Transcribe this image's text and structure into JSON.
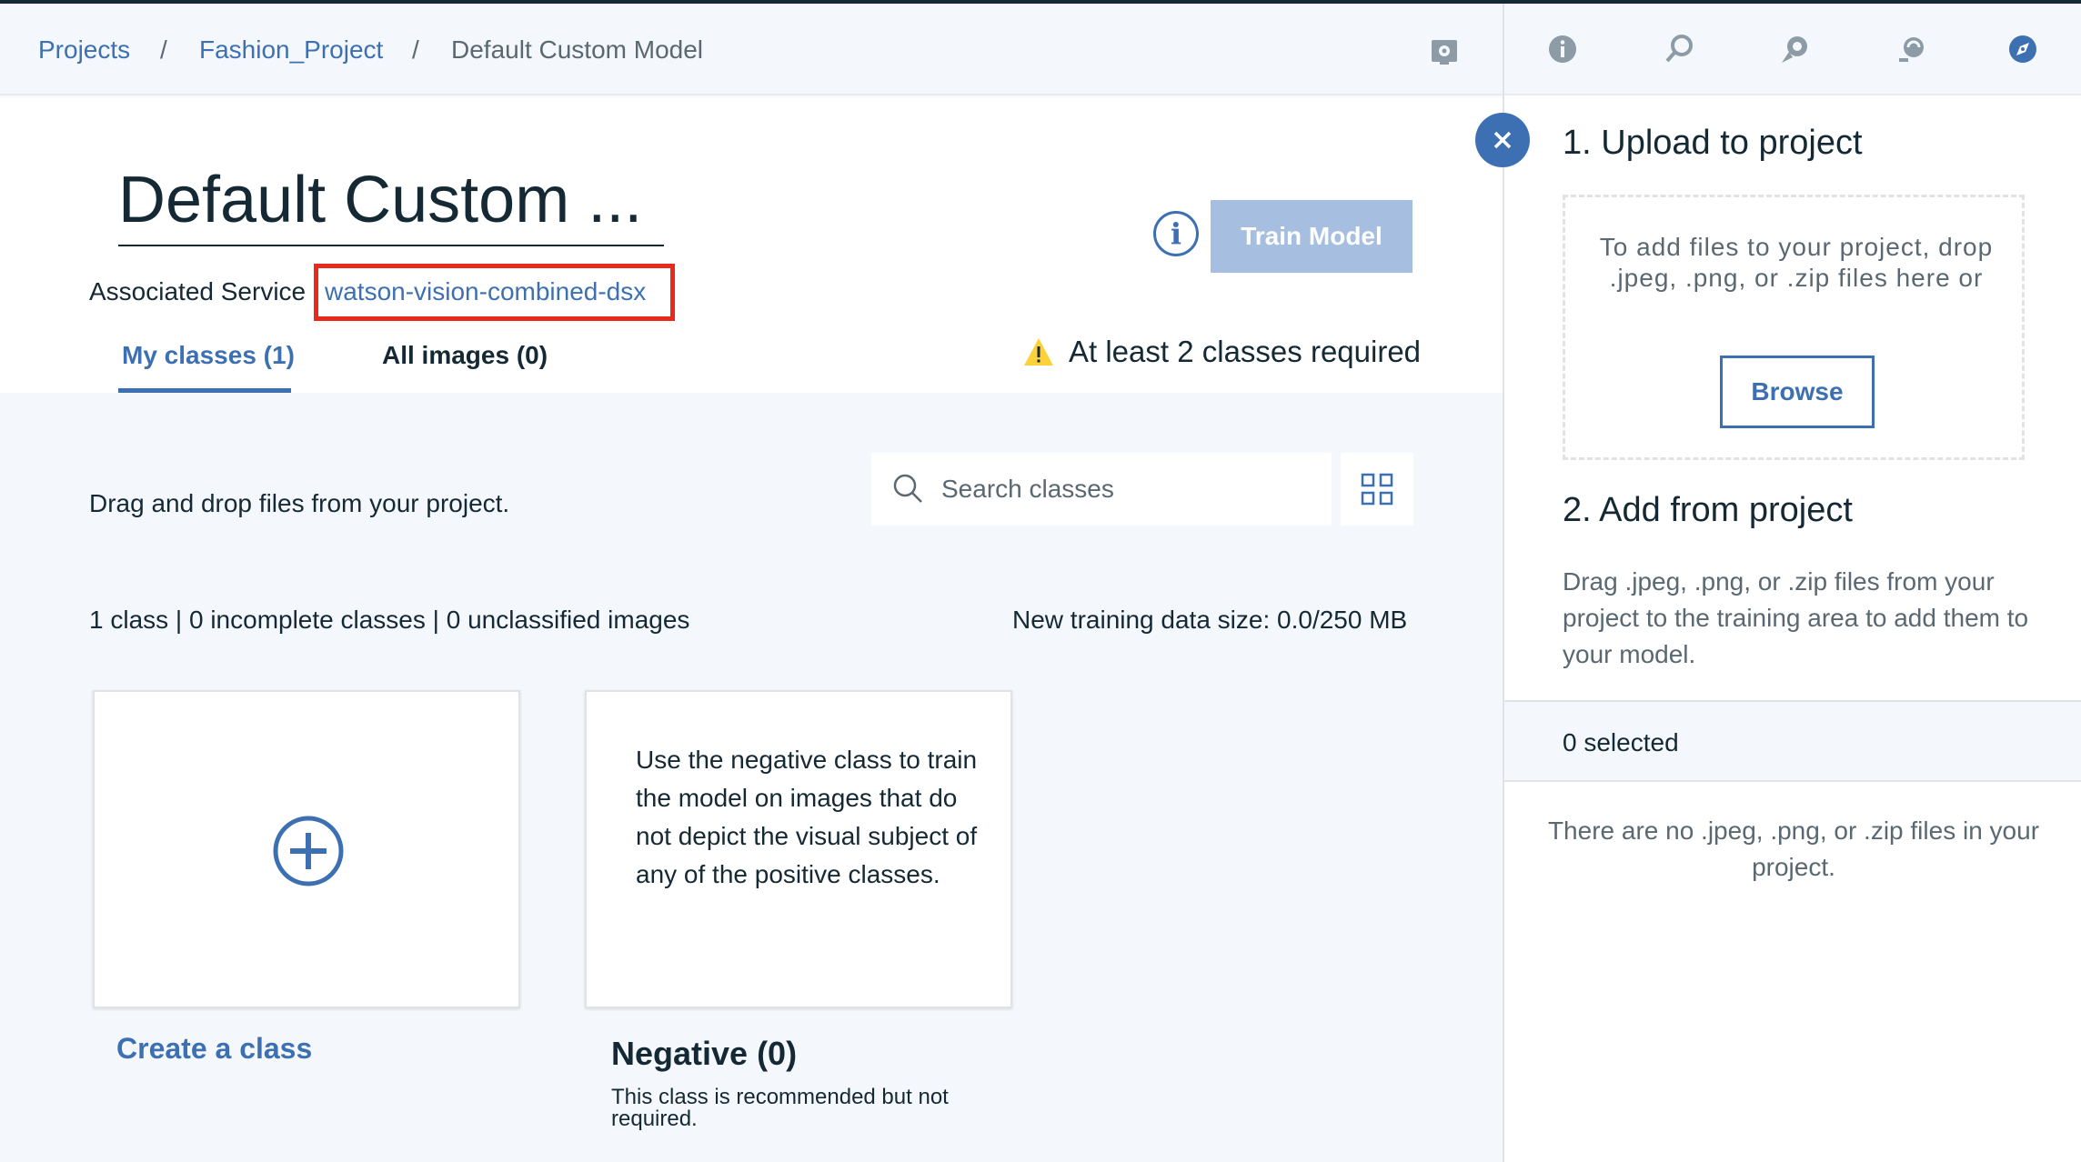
{
  "breadcrumb": {
    "items": [
      "Projects",
      "Fashion_Project",
      "Default Custom Model"
    ],
    "separator": "/"
  },
  "model": {
    "title": "Default Custom ...",
    "associated_service_label": "Associated Service",
    "associated_service_value": "watson-vision-combined-dsx"
  },
  "actions": {
    "info_glyph": "i",
    "train_label": "Train Model",
    "warning": "At least 2 classes required"
  },
  "tabs": [
    {
      "label": "My classes (1)",
      "active": true
    },
    {
      "label": "All images (0)",
      "active": false
    }
  ],
  "content": {
    "drag_hint": "Drag and drop files from your project.",
    "search_placeholder": "Search classes",
    "stats": "1 class | 0 incomplete classes | 0 unclassified images",
    "data_size": "New training data size: 0.0/250 MB"
  },
  "cards": {
    "create_label": "Create a class",
    "negative_desc": "Use the negative class to train the model on images that do not depict the visual subject of any of the positive classes.",
    "negative_title": "Negative (0)",
    "negative_note": "This class is recommended but not required."
  },
  "panel": {
    "toolbar_icons": [
      "settings-icon",
      "info-icon",
      "find-data-icon",
      "environments-icon",
      "data-assets-icon",
      "compass-icon"
    ],
    "active_tool": "data-assets-icon",
    "upload_heading": "1. Upload to project",
    "drop_text": "To add files to your project, drop .jpeg, .png, or .zip files here or",
    "browse_label": "Browse",
    "add_heading": "2. Add from project",
    "add_desc": "Drag .jpeg, .png, or .zip files from your project to the training area to add them to your model.",
    "selected_text": "0 selected",
    "empty_text": "There are no .jpeg, .png, or .zip files in your project."
  },
  "colors": {
    "accent": "#3d70b2",
    "train_disabled": "#a6bfe0",
    "highlight_box": "#e8291c",
    "warning": "#fdd13a",
    "text": "#152935",
    "muted": "#5a6872",
    "surface": "#f4f7fb"
  }
}
